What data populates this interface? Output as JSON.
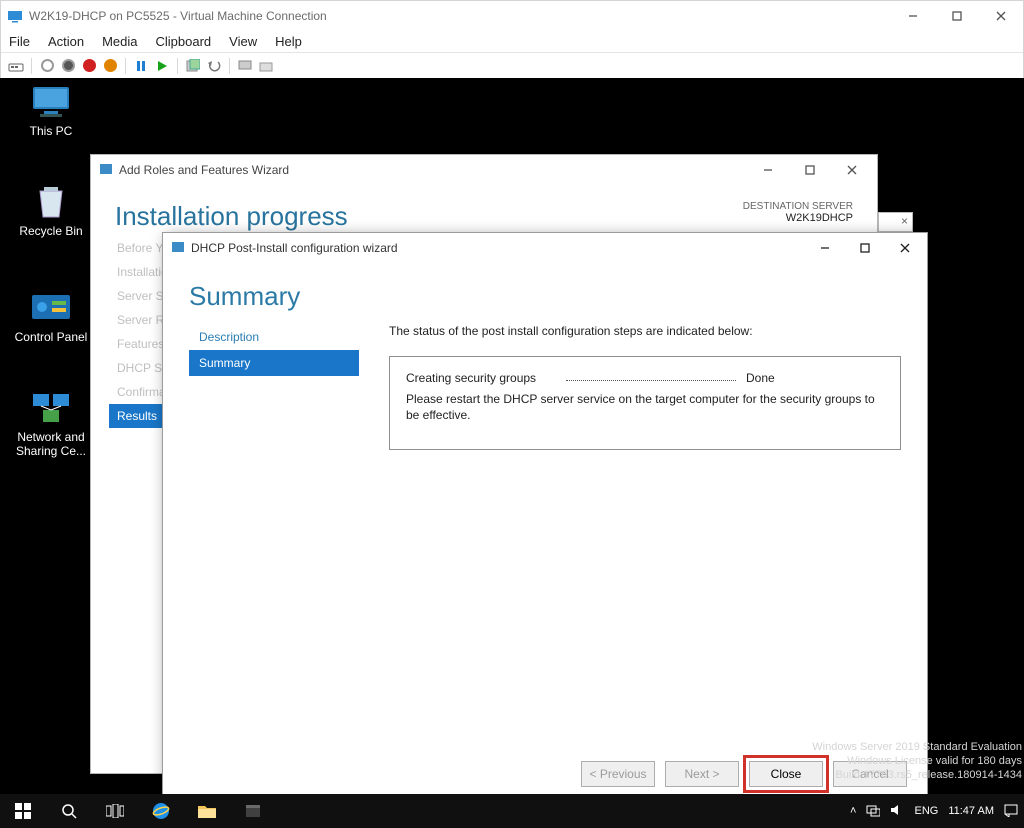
{
  "vm": {
    "title": "W2K19-DHCP on PC5525 - Virtual Machine Connection",
    "menu": [
      "File",
      "Action",
      "Media",
      "Clipboard",
      "View",
      "Help"
    ]
  },
  "desktop": {
    "icons": [
      {
        "label": "This PC"
      },
      {
        "label": "Recycle Bin"
      },
      {
        "label": "Control Panel"
      },
      {
        "label": "Network and Sharing Ce..."
      }
    ]
  },
  "wizard_roles": {
    "title": "Add Roles and Features Wizard",
    "heading": "Installation progress",
    "dest_label": "DESTINATION SERVER",
    "dest_value": "W2K19DHCP",
    "nav": [
      "Before You Begin",
      "Installation Type",
      "Server Selection",
      "Server Roles",
      "Features",
      "DHCP Server",
      "Confirmation",
      "Results"
    ],
    "active_index": 7
  },
  "wizard_dhcp": {
    "title": "DHCP Post-Install configuration wizard",
    "heading": "Summary",
    "nav": [
      "Description",
      "Summary"
    ],
    "active_index": 1,
    "intro": "The status of the post install configuration steps are indicated below:",
    "status_label": "Creating security groups",
    "status_value": "Done",
    "note": "Please restart the DHCP server service on the target computer for the security groups to be effective.",
    "buttons": {
      "prev": "< Previous",
      "next": "Next >",
      "close": "Close",
      "cancel": "Cancel"
    }
  },
  "watermark": {
    "l1": "Windows Server 2019 Standard Evaluation",
    "l2": "Windows License valid for 180 days",
    "l3": "Build 17763.rs5_release.180914-1434"
  },
  "tray": {
    "lang": "ENG",
    "time": "11:47 AM"
  }
}
